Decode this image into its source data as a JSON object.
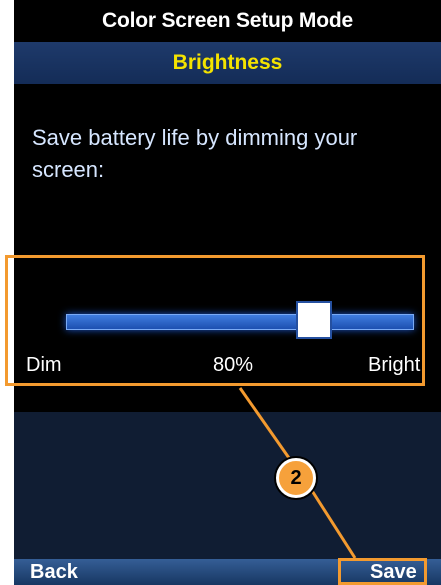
{
  "screen": {
    "title": "Color Screen Setup Mode",
    "subtitle": "Brightness",
    "description": "Save battery life by dimming your screen:"
  },
  "brightness": {
    "min_label": "Dim",
    "value_label": "80%",
    "max_label": "Bright",
    "level_percent": 80
  },
  "softkeys": {
    "back": "Back",
    "save": "Save"
  },
  "callout": {
    "number": "2"
  },
  "colors": {
    "title_text": "#ffffff",
    "subtitle_text": "#f4e300",
    "highlight": "#f39a2f",
    "slider_track": "#2f69d0",
    "header_bg": "#1e3a6b"
  },
  "icons": {
    "slider_thumb": "square-thumb",
    "callout_badge": "numbered-circle"
  }
}
